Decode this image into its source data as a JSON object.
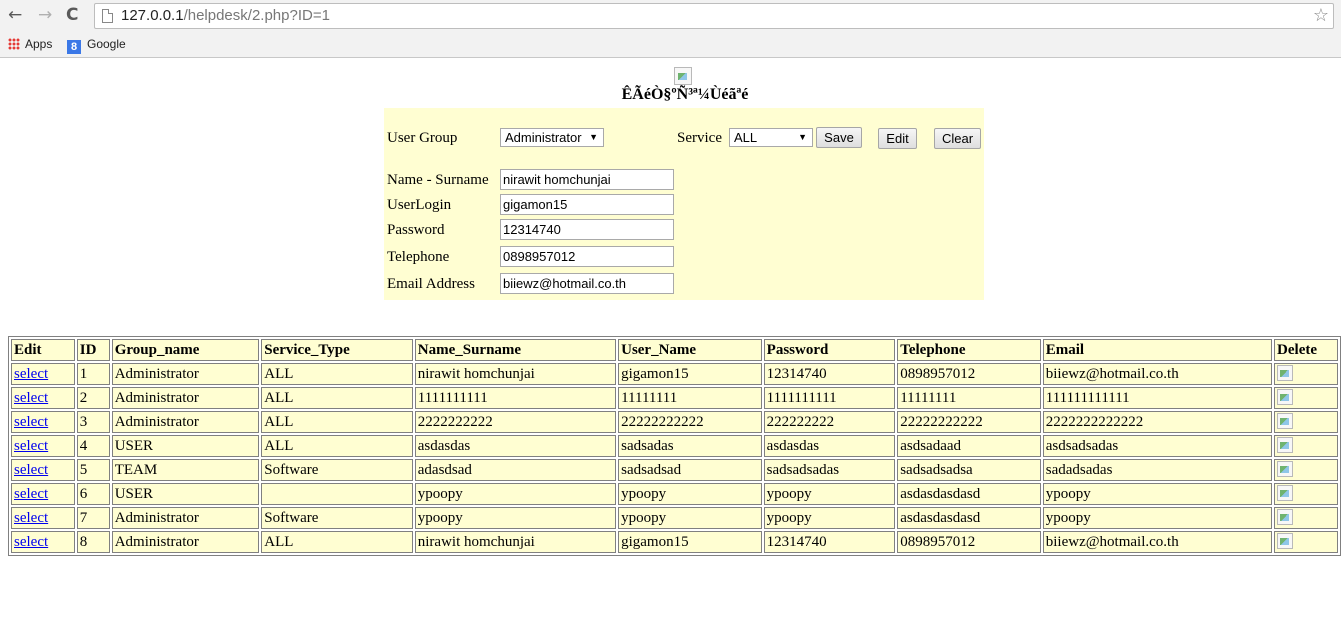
{
  "browser": {
    "url_host": "127.0.0.1",
    "url_path": "/helpdesk/2.php?ID=1",
    "bookmarks": [
      "Apps",
      "Google"
    ]
  },
  "page": {
    "heading": "ÊÃéÒ§ºÑ³ª¼Ùéãªé"
  },
  "form": {
    "user_group_label": "User Group",
    "user_group_value": "Administrator",
    "service_label": "Service",
    "service_value": "ALL",
    "save_label": "Save",
    "edit_label": "Edit",
    "clear_label": "Clear",
    "fields": [
      {
        "label": "Name - Surname",
        "value": "nirawit homchunjai"
      },
      {
        "label": "UserLogin",
        "value": "gigamon15"
      },
      {
        "label": "Password",
        "value": "12314740"
      },
      {
        "label": "Telephone",
        "value": "0898957012"
      },
      {
        "label": "Email Address",
        "value": "biiewz@hotmail.co.th"
      }
    ]
  },
  "table": {
    "headers": [
      "Edit",
      "ID",
      "Group_name",
      "Service_Type",
      "Name_Surname",
      "User_Name",
      "Password",
      "Telephone",
      "Email",
      "Delete"
    ],
    "link_text": "select",
    "rows": [
      [
        "1",
        "Administrator",
        "ALL",
        "nirawit homchunjai",
        "gigamon15",
        "12314740",
        "0898957012",
        "biiewz@hotmail.co.th"
      ],
      [
        "2",
        "Administrator",
        "ALL",
        "1111111111",
        "11111111",
        "1111111111",
        "11111111",
        "111111111111"
      ],
      [
        "3",
        "Administrator",
        "ALL",
        "2222222222",
        "22222222222",
        "222222222",
        "22222222222",
        "2222222222222"
      ],
      [
        "4",
        "USER",
        "ALL",
        "asdasdas",
        "sadsadas",
        "asdasdas",
        "asdsadaad",
        "asdsadsadas"
      ],
      [
        "5",
        "TEAM",
        "Software",
        "adasdsad",
        "sadsadsad",
        "sadsadsadas",
        "sadsadsadsa",
        "sadadsadas"
      ],
      [
        "6",
        "USER",
        "",
        "ypoopy",
        "ypoopy",
        "ypoopy",
        "asdasdasdasd",
        "ypoopy"
      ],
      [
        "7",
        "Administrator",
        "Software",
        "ypoopy",
        "ypoopy",
        "ypoopy",
        "asdasdasdasd",
        "ypoopy"
      ],
      [
        "8",
        "Administrator",
        "ALL",
        "nirawit homchunjai",
        "gigamon15",
        "12314740",
        "0898957012",
        "biiewz@hotmail.co.th"
      ]
    ]
  }
}
